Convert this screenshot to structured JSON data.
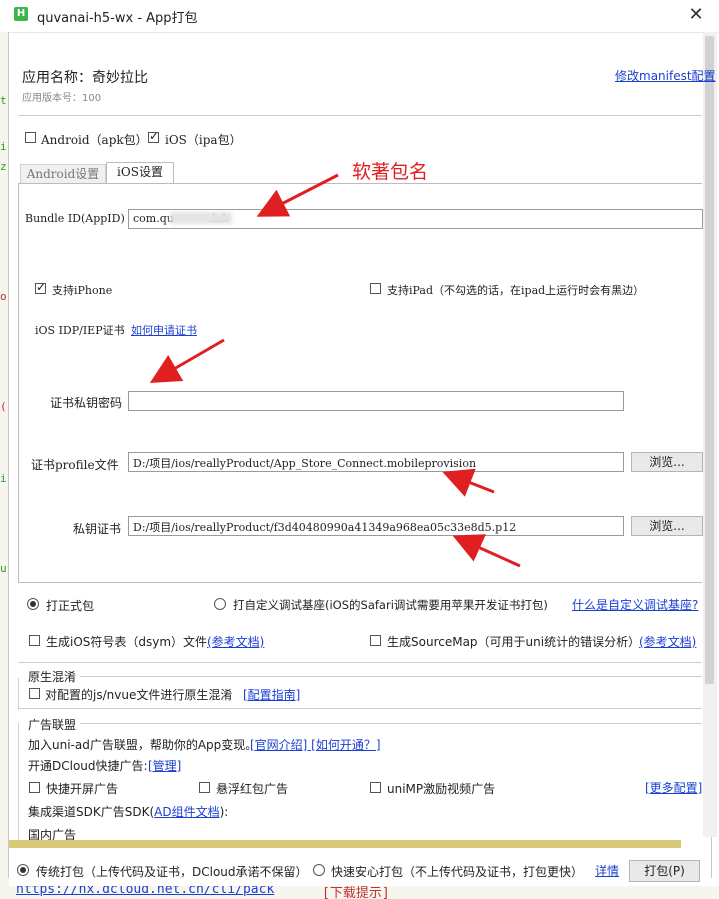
{
  "window": {
    "title": "quvanai-h5-wx - App打包",
    "icon_letter": "H",
    "close_label": "✕"
  },
  "header": {
    "app_name_label": "应用名称：奇妙拉比",
    "version_label": "应用版本号：100",
    "manifest_link": "修改manifest配置"
  },
  "platforms": [
    {
      "label": "Android（apk包）",
      "checked": false
    },
    {
      "label": "iOS（ipa包）",
      "checked": true
    }
  ],
  "tabs": [
    {
      "label": "Android设置",
      "active": false
    },
    {
      "label": "iOS设置",
      "active": true
    }
  ],
  "ios": {
    "bundle_label": "Bundle ID(AppID)",
    "bundle_value": "com.qu          .lab",
    "support_iphone": "支持iPhone",
    "support_ipad": "支持iPad（不勾选的话，在ipad上运行时会有黑边）",
    "cert_label": "iOS IDP/IEP证书",
    "cert_link": "如何申请证书",
    "cert_pwd_label": "证书私钥密码",
    "cert_pwd_value": "",
    "profile_label": "证书profile文件",
    "profile_value": "D:/项目/ios/reallyProduct/App_Store_Connect.mobileprovision",
    "private_cert_label": "私钥证书",
    "private_cert_value": "D:/项目/ios/reallyProduct/f3d40480990a41349a968ea05c33e8d5.p12",
    "browse_label": "浏览..."
  },
  "annotation": {
    "text": "软著包名"
  },
  "package_type": {
    "formal": "打正式包",
    "custom": "打自定义调试基座(iOS的Safari调试需要用苹果开发证书打包)",
    "custom_link": "什么是自定义调试基座?"
  },
  "options": {
    "dsym": "生成iOS符号表（dsym）文件",
    "dsym_link": "(参考文档)",
    "sourcemap": "生成SourceMap（可用于uni统计的错误分析）",
    "sourcemap_link": "(参考文档)"
  },
  "obfuscation": {
    "title": "原生混淆",
    "option": "对配置的js/nvue文件进行原生混淆",
    "link": "[配置指南]"
  },
  "ads": {
    "title": "广告联盟",
    "join_text": "加入uni-ad广告联盟，帮助你的App变现。",
    "join_link": "[官网介绍] [如何开通？]",
    "dcloud_text": "开通DCloud快捷广告:",
    "manage_link": "[管理]",
    "splash": "快捷开屏广告",
    "redpack": "悬浮红包广告",
    "video": "uniMP激励视频广告",
    "more_link": "[更多配置]",
    "sdk_prefix": "集成渠道SDK广告SDK(",
    "sdk_link": "AD组件文档",
    "sdk_suffix": "):",
    "domestic": "国内广告"
  },
  "footer": {
    "traditional": "传统打包（上传代码及证书，DCloud承诺不保留）",
    "fast": "快速安心打包（不上传代码及证书，打包更快）",
    "details_link": "详情",
    "pack_button": "打包(P)",
    "behind_url": "https://nx.dcloud.net.cn/cli/pack",
    "behind_bracket": "[下载提示]"
  },
  "colors": {
    "annotation": "#e02020",
    "link": "#1a3fd1",
    "scrollbar": "#d8c979"
  }
}
